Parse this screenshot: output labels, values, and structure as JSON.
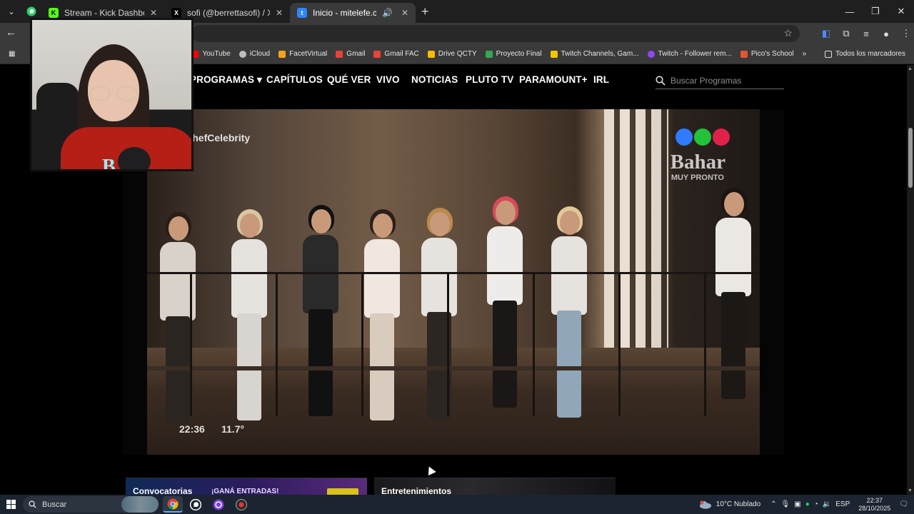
{
  "browser": {
    "tabs": [
      {
        "title": "Stream - Kick Dashboard",
        "favicon": "kick-icon",
        "color": "#53fc18"
      },
      {
        "title": "sofi (@berrettasofi) / X",
        "favicon": "x-icon",
        "color": "#ffffff"
      },
      {
        "title": "Inicio - mitelefe.com",
        "favicon": "telefe-icon",
        "color": "#2b86ff",
        "active": true
      }
    ],
    "pinned_tab_icon": "whatsapp-icon",
    "new_tab_label": "+",
    "bookmarks": [
      {
        "label": "YouTube",
        "color": "#ff0000"
      },
      {
        "label": "iCloud",
        "color": "#bdbdbd"
      },
      {
        "label": "FacetVirtual",
        "color": "#f2a21b"
      },
      {
        "label": "Gmail",
        "color": "#ea4335"
      },
      {
        "label": "Gmail FAC",
        "color": "#ea4335"
      },
      {
        "label": "Drive QCTY",
        "color": "#fbbc04"
      },
      {
        "label": "Proyecto Final",
        "color": "#34a853"
      },
      {
        "label": "Twitch Channels, Gam...",
        "color": "#f5c400"
      },
      {
        "label": "Twitch - Follower rem...",
        "color": "#9146ff"
      },
      {
        "label": "Pico's School",
        "color": "#e4572e"
      }
    ],
    "bookmarks_overflow": "»",
    "all_bookmarks": "Todos los marcadores"
  },
  "site": {
    "nav": [
      {
        "label": "PROGRAMAS ▾"
      },
      {
        "label": "CAPÍTULOS"
      },
      {
        "label": "QUÉ VER"
      },
      {
        "label": "VIVO"
      },
      {
        "label": "NOTICIAS"
      },
      {
        "label": "PLUTO TV"
      },
      {
        "label": "PARAMOUNT+"
      },
      {
        "label": "IRL"
      }
    ],
    "search_placeholder": "Buscar Programas",
    "video": {
      "show_title": "MasterChefCelebrity",
      "brand": "Bahar",
      "brand_sub": "MUY PRONTO",
      "time": "22:36",
      "temperature": "11.7°",
      "logo_colors": [
        "#2f7bff",
        "#22c23a",
        "#e0224a"
      ]
    },
    "cards": [
      {
        "label": "Convocatorias",
        "promo": "¡GANÁ ENTRADAS!"
      },
      {
        "label": "Entretenimientos"
      }
    ]
  },
  "webcam": {
    "mark": "B"
  },
  "taskbar": {
    "search_placeholder": "Buscar",
    "weather": "10°C Nublado",
    "language": "ESP",
    "time": "22:37",
    "date": "28/10/2025",
    "notification_count": "1"
  }
}
